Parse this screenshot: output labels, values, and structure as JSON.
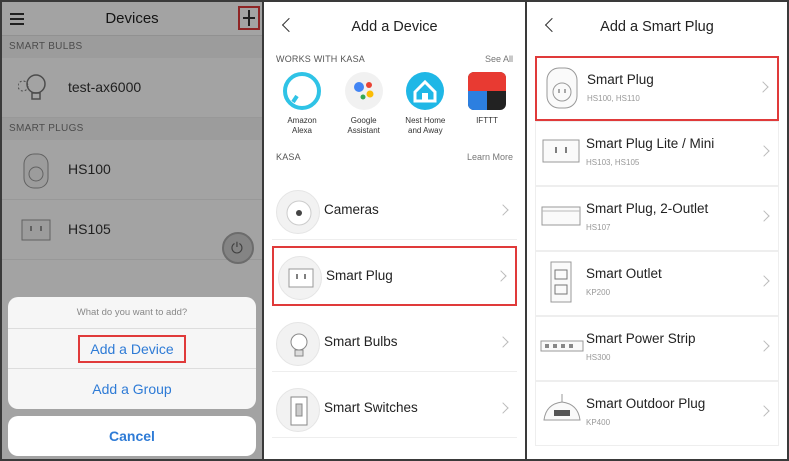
{
  "panel1": {
    "title": "Devices",
    "sections": [
      {
        "label": "SMART BULBS",
        "devices": [
          {
            "name": "test-ax6000"
          }
        ]
      },
      {
        "label": "SMART PLUGS",
        "devices": [
          {
            "name": "HS100"
          },
          {
            "name": "HS105"
          }
        ]
      }
    ],
    "sheet": {
      "prompt": "What do you want to add?",
      "options": [
        "Add a Device",
        "Add a Group"
      ],
      "cancel": "Cancel"
    }
  },
  "panel2": {
    "title": "Add a Device",
    "works_with": {
      "label": "WORKS WITH KASA",
      "link": "See All"
    },
    "apps": [
      {
        "name": "Amazon\nAlexa",
        "icon": "alexa-icon",
        "color": "#2fc3e6"
      },
      {
        "name": "Google\nAssistant",
        "icon": "google-assistant-icon",
        "color": "#4285f4"
      },
      {
        "name": "Nest Home\nand Away",
        "icon": "nest-icon",
        "color": "#1fb7e6"
      },
      {
        "name": "IFTTT",
        "icon": "ifttt-icon",
        "color": "#e83a32"
      }
    ],
    "kasa": {
      "label": "KASA",
      "link": "Learn More"
    },
    "categories": [
      "Cameras",
      "Smart Plug",
      "Smart Bulbs",
      "Smart Switches"
    ]
  },
  "panel3": {
    "title": "Add a Smart Plug",
    "products": [
      {
        "name": "Smart Plug",
        "models": "HS100, HS110"
      },
      {
        "name": "Smart Plug Lite / Mini",
        "models": "HS103, HS105"
      },
      {
        "name": "Smart Plug, 2-Outlet",
        "models": "HS107"
      },
      {
        "name": "Smart Outlet",
        "models": "KP200"
      },
      {
        "name": "Smart Power Strip",
        "models": "HS300"
      },
      {
        "name": "Smart Outdoor Plug",
        "models": "KP400"
      }
    ]
  },
  "colors": {
    "highlight": "#e03a3a",
    "link_blue": "#2e7bd6"
  }
}
